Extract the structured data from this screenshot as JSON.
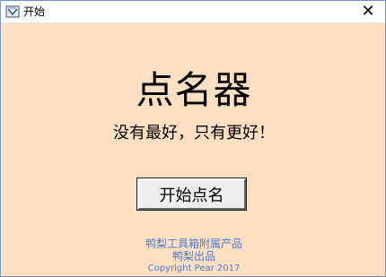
{
  "window": {
    "title": "开始",
    "close_symbol": "✕"
  },
  "main": {
    "heading": "点名器",
    "slogan": "没有最好，只有更好！",
    "start_button_label": "开始点名"
  },
  "footer": {
    "line1": "鸭梨工具箱附属产品",
    "line2": "鸭梨出品",
    "line3": "Copyright Pear 2017"
  },
  "colors": {
    "background": "#ffe0c2",
    "footer_text": "#4a7bd1"
  },
  "icons": {
    "app_icon": "app-icon",
    "close_icon": "close-icon"
  }
}
